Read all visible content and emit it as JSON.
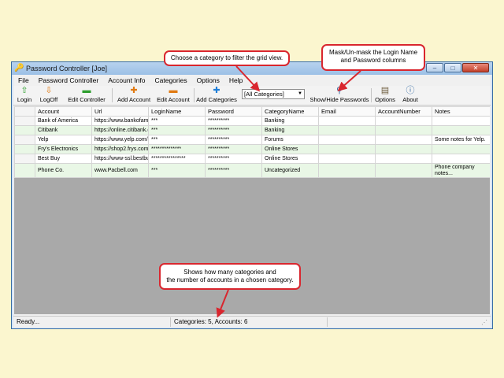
{
  "window": {
    "title": "Password Controller [Joe]",
    "buttons": {
      "minimize": "–",
      "maximize": "□",
      "close": "✕"
    }
  },
  "menu": [
    "File",
    "Password Controller",
    "Account Info",
    "Categories",
    "Options",
    "Help"
  ],
  "toolbar": {
    "login": "Login",
    "logoff": "LogOff",
    "edit_controller": "Edit Controller",
    "add_account": "Add Account",
    "edit_account": "Edit Account",
    "add_categories": "Add Categories",
    "category_filter": "[All Categories]",
    "show_hide": "Show/Hide Passwords",
    "options": "Options",
    "about": "About"
  },
  "grid": {
    "columns": [
      "Account",
      "Url",
      "LoginName",
      "Password",
      "CategoryName",
      "Email",
      "AccountNumber",
      "Notes"
    ],
    "rows": [
      [
        "Bank of America",
        "https://www.bankofam",
        "***",
        "**********",
        "Banking",
        "",
        "",
        ""
      ],
      [
        "Citibank",
        "https://online.citibank.c",
        "***",
        "**********",
        "Banking",
        "",
        "",
        ""
      ],
      [
        "Yelp",
        "https://www.yelp.com/",
        "***",
        "**********",
        "Forums",
        "",
        "",
        "Some notes for Yelp."
      ],
      [
        "Fry's Electronics",
        "https://shop2.frys.com.",
        "**************",
        "**********",
        "Online Stores",
        "",
        "",
        ""
      ],
      [
        "Best Buy",
        "https://www-ssl.bestbu",
        "****************",
        "**********",
        "Online Stores",
        "",
        "",
        ""
      ],
      [
        "Phone Co.",
        "www.Pacbell.com",
        "***",
        "**********",
        "Uncategorized",
        "",
        "",
        "Phone company notes..."
      ]
    ]
  },
  "status": {
    "left": "Ready...",
    "middle": "Categories: 5, Accounts: 6"
  },
  "callouts": {
    "filter": "Choose a category to filter the grid view.",
    "mask_line1": "Mask/Un-mask the Login Name",
    "mask_line2": "and Password columns",
    "count_line1": "Shows how many categories and",
    "count_line2": "the number of accounts in a chosen category."
  },
  "colors": {
    "callout_border": "#d9262e",
    "alt_row": "#e9f7e6",
    "page_bg": "#fbf6cf"
  }
}
